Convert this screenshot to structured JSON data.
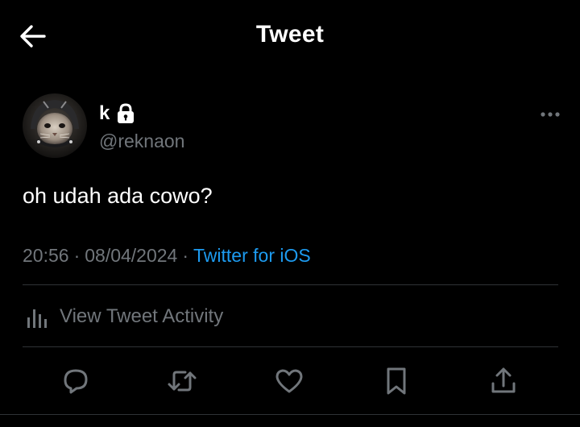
{
  "header": {
    "title": "Tweet",
    "back_icon": "arrow-left-icon"
  },
  "author": {
    "display_name": "k",
    "protected_icon": "lock-icon",
    "handle": "@reknaon",
    "avatar_desc": "cat-avatar"
  },
  "tweet": {
    "text": "oh udah ada cowo?",
    "time": "20:56",
    "separator": "·",
    "date": "08/04/2024",
    "source": "Twitter for iOS"
  },
  "activity": {
    "label": "View Tweet Activity",
    "icon": "analytics-icon"
  },
  "actions": [
    {
      "name": "reply",
      "icon": "reply-icon"
    },
    {
      "name": "retweet",
      "icon": "retweet-icon"
    },
    {
      "name": "like",
      "icon": "heart-icon"
    },
    {
      "name": "bookmark",
      "icon": "bookmark-icon"
    },
    {
      "name": "share",
      "icon": "share-icon"
    }
  ],
  "colors": {
    "background": "#000000",
    "primary_text": "#ffffff",
    "secondary_text": "#71767b",
    "accent": "#1d9bf0",
    "divider": "#2f3336"
  }
}
